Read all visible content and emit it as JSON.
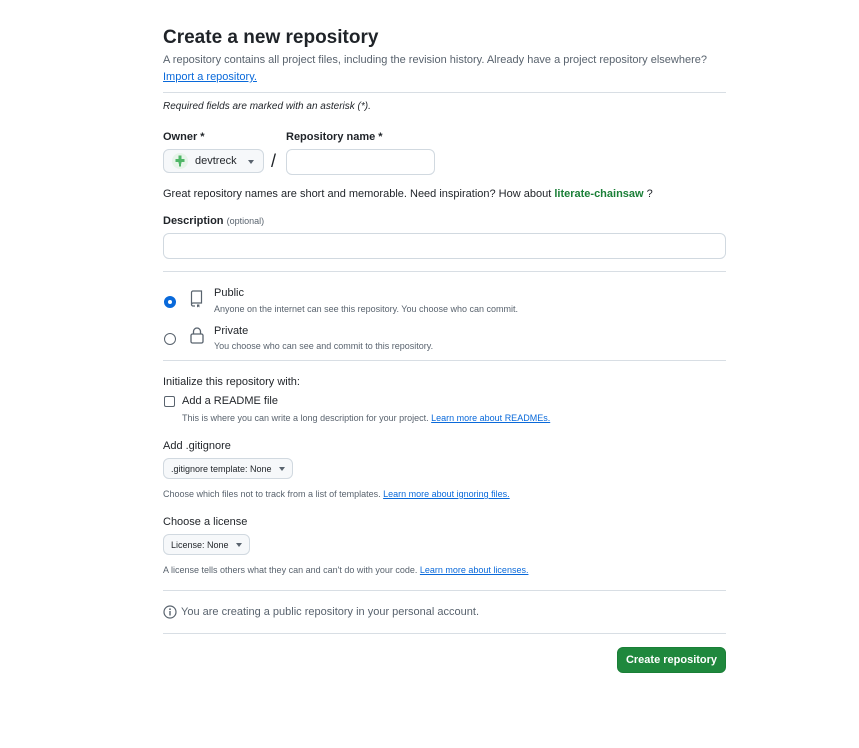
{
  "header": {
    "title": "Create a new repository",
    "subtitle": "A repository contains all project files, including the revision history. Already have a project repository elsewhere?",
    "import_link": "Import a repository."
  },
  "required_note": "Required fields are marked with an asterisk (*).",
  "owner": {
    "label": "Owner *",
    "value": "devtreck"
  },
  "repo_name": {
    "label": "Repository name *",
    "value": "",
    "separator": "/"
  },
  "suggestion": {
    "text": "Great repository names are short and memorable. Need inspiration? How about",
    "name": "literate-chainsaw",
    "end": "?"
  },
  "description": {
    "label": "Description",
    "optional": "(optional)",
    "value": ""
  },
  "visibility": {
    "public": {
      "label": "Public",
      "desc": "Anyone on the internet can see this repository. You choose who can commit.",
      "checked": true
    },
    "private": {
      "label": "Private",
      "desc": "You choose who can see and commit to this repository.",
      "checked": false
    }
  },
  "init": {
    "heading": "Initialize this repository with:",
    "readme_label": "Add a README file",
    "readme_desc": "This is where you can write a long description for your project.",
    "readme_link": "Learn more about READMEs."
  },
  "gitignore": {
    "heading": "Add .gitignore",
    "select": ".gitignore template: None",
    "desc": "Choose which files not to track from a list of templates.",
    "link": "Learn more about ignoring files."
  },
  "license": {
    "heading": "Choose a license",
    "select": "License: None",
    "desc": "A license tells others what they can and can't do with your code.",
    "link": "Learn more about licenses."
  },
  "info_note": "You are creating a public repository in your personal account.",
  "create_button": "Create repository",
  "colors": {
    "primary_button": "#1f883d",
    "link": "#0969da",
    "suggestion": "#1a7f37"
  }
}
